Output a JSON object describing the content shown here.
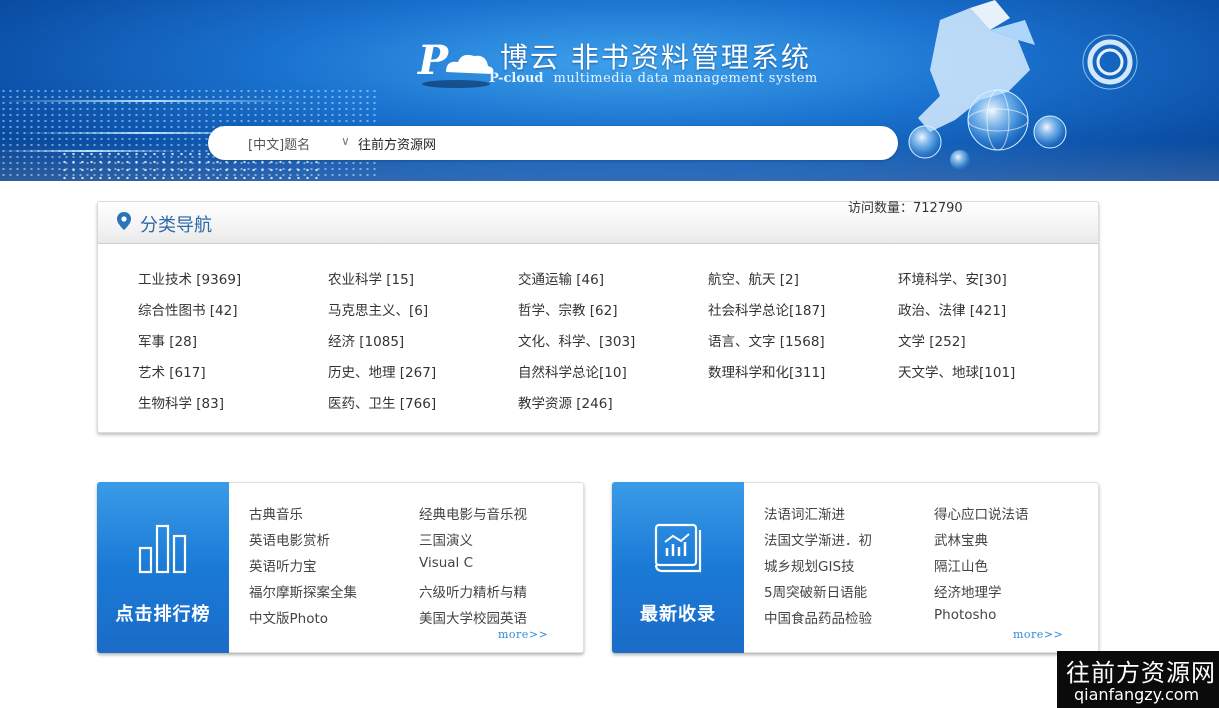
{
  "banner": {
    "brand_cn": "博云 非书资料管理系统",
    "brand_en_name": "P-cloud",
    "brand_en_sub": "multimedia data management system",
    "logo_letter": "P"
  },
  "search": {
    "field_label": "[中文]题名",
    "value": "往前方资源网"
  },
  "category_nav": {
    "title": "分类导航",
    "visits": "访问数量：712790",
    "items": [
      [
        "工业技术 [9369]",
        "农业科学 [15]",
        "交通运输 [46]",
        "航空、航天 [2]",
        "环境科学、安[30]"
      ],
      [
        "综合性图书 [42]",
        "马克思主义、[6]",
        "哲学、宗教 [62]",
        "社会科学总论[187]",
        "政治、法律 [421]"
      ],
      [
        "军事 [28]",
        "经济 [1085]",
        "文化、科学、[303]",
        "语言、文字 [1568]",
        "文学 [252]"
      ],
      [
        "艺术 [617]",
        "历史、地理 [267]",
        "自然科学总论[10]",
        "数理科学和化[311]",
        "天文学、地球[101]"
      ],
      [
        "生物科学 [83]",
        "医药、卫生 [766]",
        "教学资源 [246]"
      ]
    ]
  },
  "ranking_card": {
    "label": "点击排行榜",
    "col1": [
      "古典音乐",
      "英语电影赏析",
      "英语听力宝",
      "福尔摩斯探案全集",
      "中文版Photo"
    ],
    "col2": [
      "经典电影与音乐视",
      "三国演义",
      "Visual C",
      "六级听力精析与精",
      "美国大学校园英语"
    ],
    "more": "more>>"
  },
  "latest_card": {
    "label": "最新收录",
    "col1": [
      "法语词汇渐进",
      "法国文学渐进．初",
      "城乡规划GIS技",
      "5周突破新日语能",
      "中国食品药品检验"
    ],
    "col2": [
      "得心应口说法语",
      "武林宝典",
      "隔江山色",
      "经济地理学",
      "Photosho"
    ],
    "more": "more>>"
  },
  "watermark": {
    "cn": "往前方资源网",
    "en": "qianfangzy.com"
  },
  "icons": {
    "location": "map-pin-icon",
    "ranking": "bar-chart-icon",
    "latest": "book-chart-icon"
  },
  "colors": {
    "banner_blue": "#1a72cf",
    "title_blue": "#2a6aa6",
    "tile_blue": "#1a7ad6",
    "more_link": "#2d8bd8"
  }
}
